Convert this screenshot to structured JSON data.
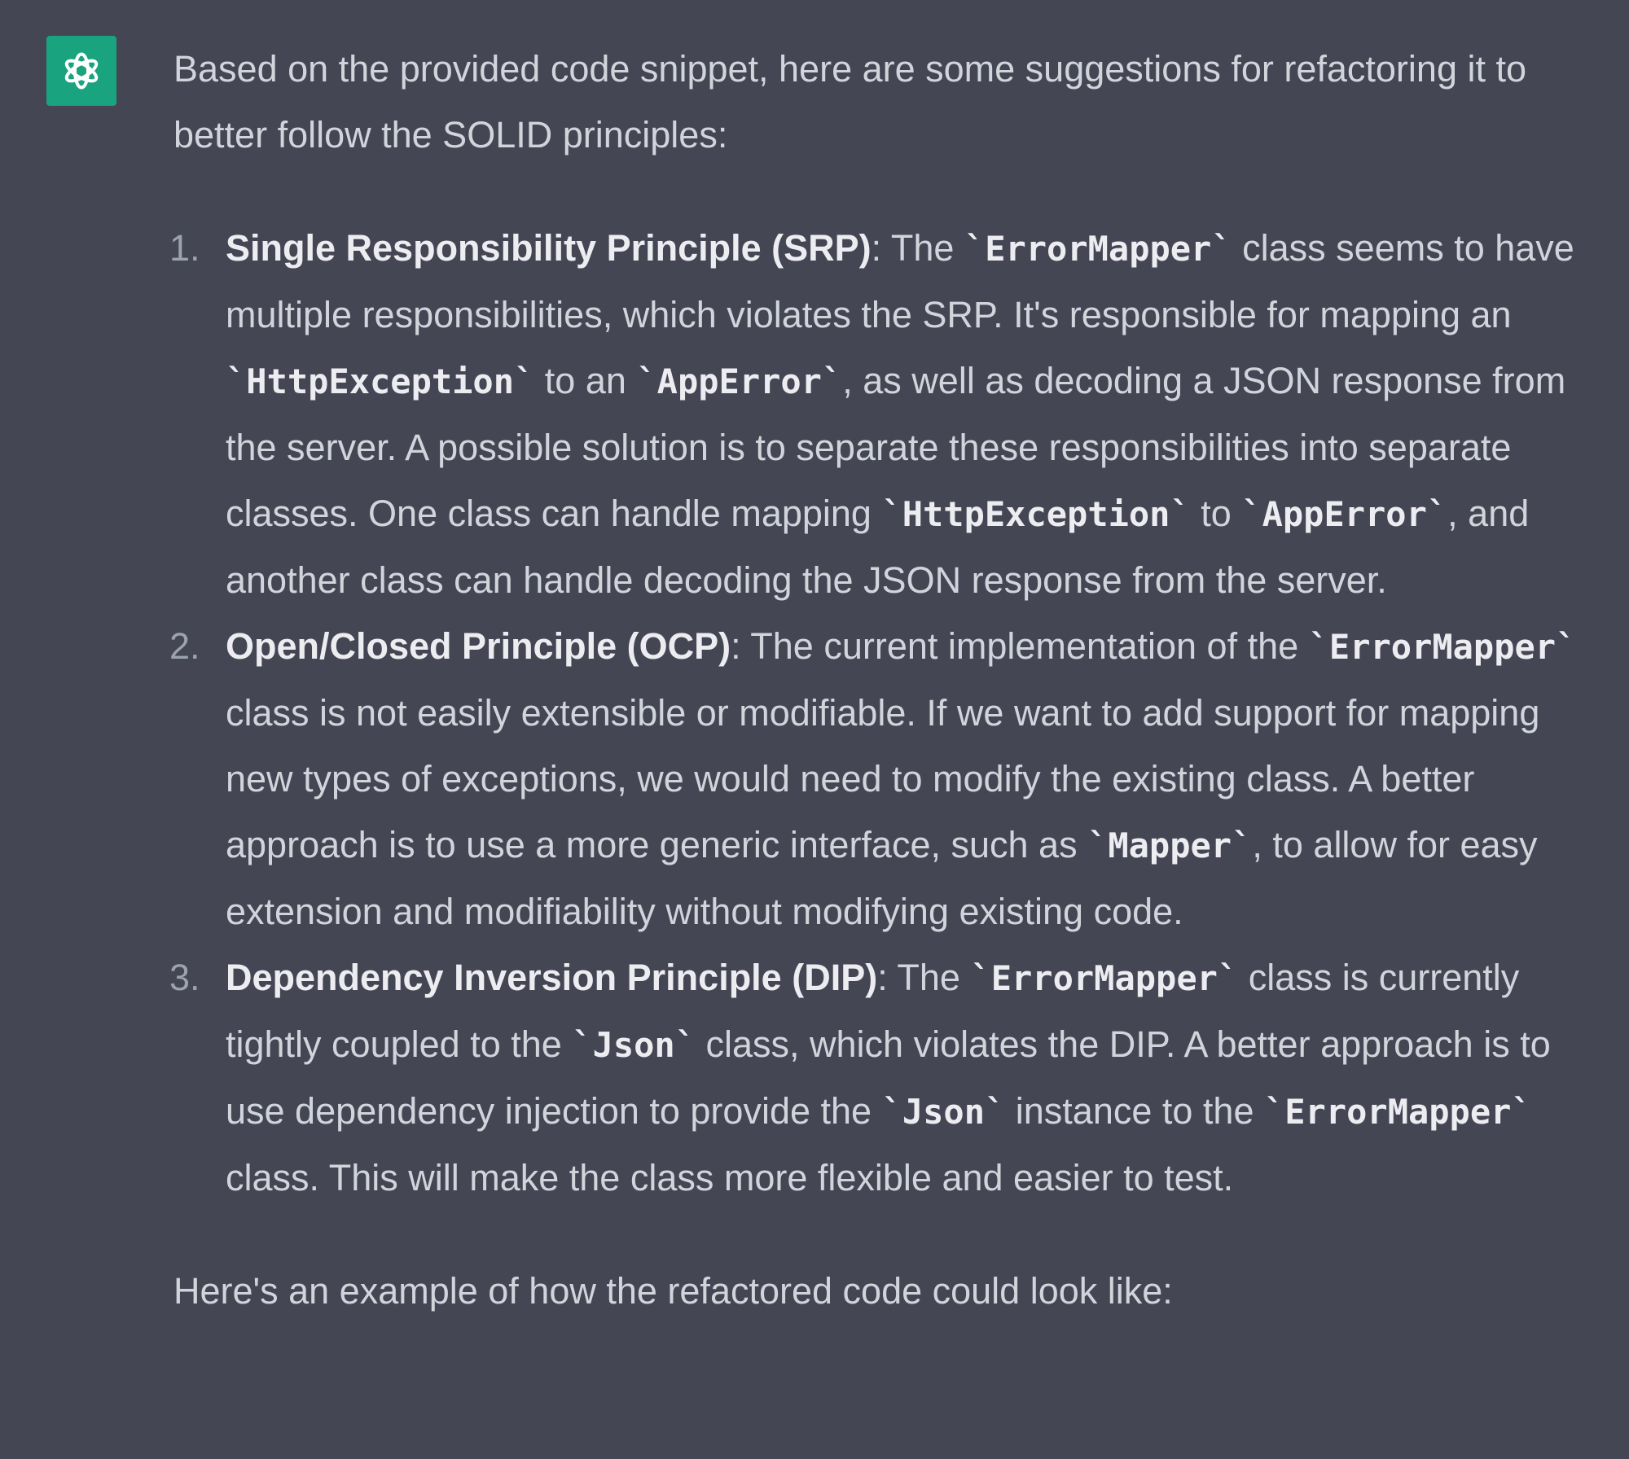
{
  "assistant": {
    "avatar_icon": "openai-logo-icon",
    "avatar_color": "#19a37f"
  },
  "message": {
    "intro": "Based on the provided code snippet, here are some suggestions for refactoring it to better follow the SOLID principles:",
    "items": [
      {
        "number": "1.",
        "title": "Single Responsibility Principle (SRP)",
        "p1": ": The ",
        "c1": "`ErrorMapper`",
        "p2": " class seems to have multiple responsibilities, which violates the SRP. It's responsible for mapping an ",
        "c2": "`HttpException`",
        "p3": " to an ",
        "c3": "`AppError`",
        "p4": ", as well as decoding a JSON response from the server. A possible solution is to separate these responsibilities into separate classes. One class can handle mapping ",
        "c4": "`HttpException`",
        "p5": " to ",
        "c5": "`AppError`",
        "p6": ", and another class can handle decoding the JSON response from the server."
      },
      {
        "number": "2.",
        "title": "Open/Closed Principle (OCP)",
        "p1": ": The current implementation of the ",
        "c1": "`ErrorMapper`",
        "p2": " class is not easily extensible or modifiable. If we want to add support for mapping new types of exceptions, we would need to modify the existing class. A better approach is to use a more generic interface, such as ",
        "c2": "`Mapper`",
        "p3": ", to allow for easy extension and modifiability without modifying existing code."
      },
      {
        "number": "3.",
        "title": "Dependency Inversion Principle (DIP)",
        "p1": ": The ",
        "c1": "`ErrorMapper`",
        "p2": " class is currently tightly coupled to the ",
        "c2": "`Json`",
        "p3": " class, which violates the DIP. A better approach is to use dependency injection to provide the ",
        "c3": "`Json`",
        "p4": " instance to the ",
        "c4": "`ErrorMapper`",
        "p5": " class. This will make the class more flexible and easier to test."
      }
    ],
    "outro": "Here's an example of how the refactored code could look like:"
  }
}
